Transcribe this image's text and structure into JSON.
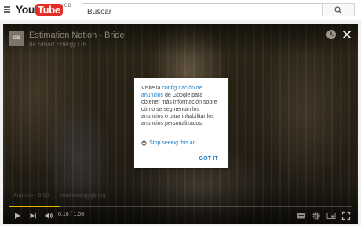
{
  "masthead": {
    "logo_you": "You",
    "logo_tube": "Tube",
    "logo_region": "GB",
    "search_placeholder": "Buscar",
    "icons": {
      "menu": "menu-icon",
      "search": "search-icon"
    }
  },
  "video": {
    "title": "Estimation Nation - Bride",
    "channel": "de Smart Energy GB",
    "channel_thumb_text": "GB",
    "ad_label": "Anuncio · 0:58",
    "ad_url": "smartenergygb.org",
    "icons": {
      "watch_later": "clock-icon",
      "close": "close-icon"
    }
  },
  "ad_dialog": {
    "text_before": "Visite la ",
    "link_text": "configuración de anuncios",
    "text_after": " de Google para obtener más información sobre cómo se segmentan los anuncios o para inhabilitar los anuncios personalizados.",
    "stop_label": "Stop seeing this ad",
    "got_it_label": "GOT IT"
  },
  "controls": {
    "current_time": "0:10",
    "duration": "1:08",
    "time_separator": " / ",
    "progress": 0.15,
    "progress_color": "#e8b500",
    "icons": [
      "play-icon",
      "next-icon",
      "volume-icon",
      "subtitles-icon",
      "settings-icon",
      "miniplayer-icon",
      "fullscreen-icon"
    ]
  },
  "colors": {
    "brand_red": "#e52d27",
    "link_blue": "#167ac6"
  }
}
